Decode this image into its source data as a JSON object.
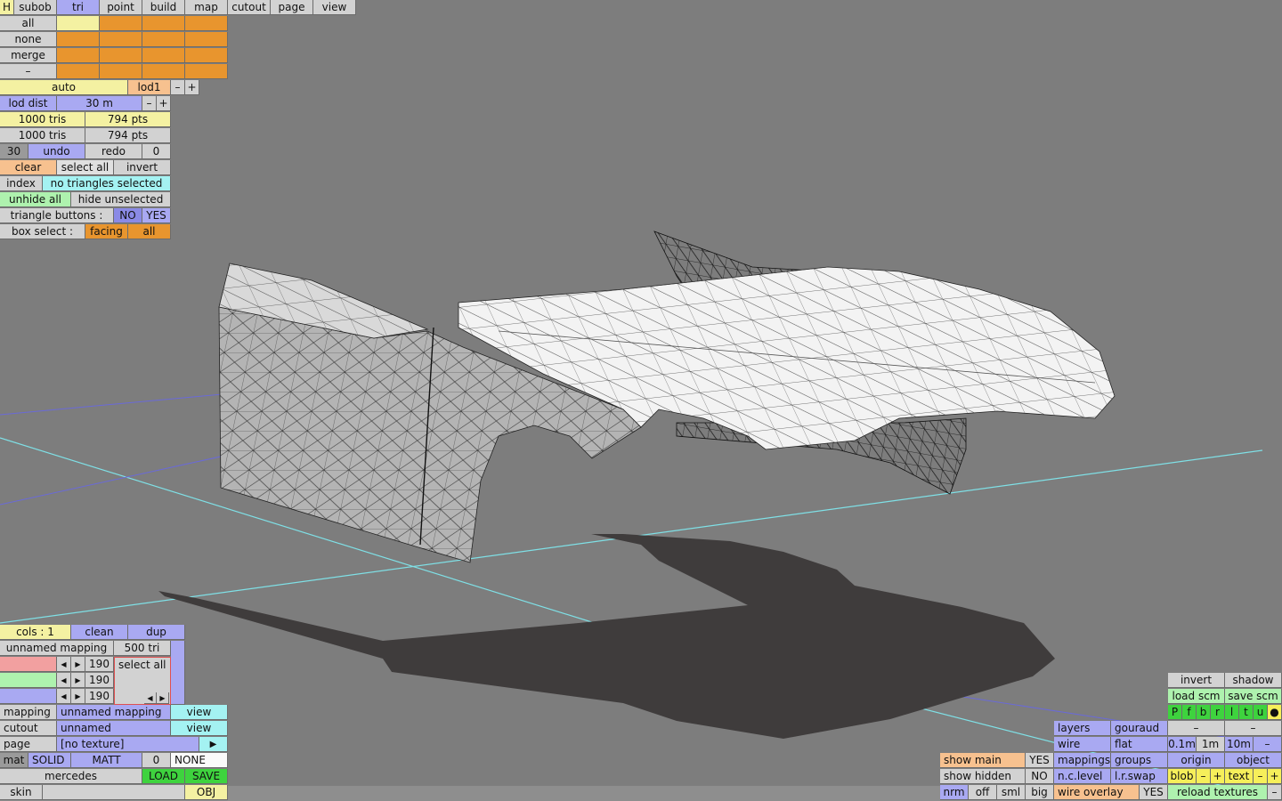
{
  "menu": {
    "h": "H",
    "tabs": [
      "subob",
      "tri",
      "point",
      "build",
      "map",
      "cutout",
      "page",
      "view"
    ],
    "active": "tri"
  },
  "selection": {
    "all": "all",
    "none": "none",
    "merge": "merge",
    "minus": "–"
  },
  "lod": {
    "auto": "auto",
    "level": "lod1",
    "minus": "–",
    "plus": "+",
    "dist_label": "lod dist",
    "dist_value": "30 m"
  },
  "counts": {
    "tris1": "1000 tris",
    "pts1": "794 pts",
    "tris2": "1000 tris",
    "pts2": "794 pts"
  },
  "history": {
    "steps": "30",
    "undo": "undo",
    "redo": "redo",
    "redo_count": "0"
  },
  "tri_tools": {
    "clear": "clear",
    "select_all": "select all",
    "invert": "invert",
    "index": "index",
    "status": "no triangles selected",
    "unhide_all": "unhide all",
    "hide_unselected": "hide unselected",
    "tri_buttons_label": "triangle buttons :",
    "no": "NO",
    "yes": "YES",
    "box_select_label": "box select :",
    "facing": "facing",
    "box_all": "all"
  },
  "mapping_panel": {
    "cols": "cols : 1",
    "clean": "clean",
    "dup": "dup",
    "mapping_name": "unnamed mapping",
    "tri_count": "500 tri",
    "rgb_values": [
      "190",
      "190",
      "190"
    ],
    "select_all": "select all",
    "mapping_label": "mapping",
    "mapping_value": "unnamed mapping",
    "view1": "view",
    "cutout_label": "cutout",
    "cutout_value": "unnamed",
    "view2": "view",
    "page_label": "page",
    "page_value": "[no texture]",
    "mat": "mat",
    "solid": "SOLID",
    "matt": "MATT",
    "mat_num": "0",
    "none": "NONE",
    "skin_name": "mercedes",
    "load": "LOAD",
    "save": "SAVE",
    "skin": "skin",
    "obj": "OBJ"
  },
  "view_panel": {
    "invert": "invert",
    "shadow": "shadow",
    "load_scm": "load scm",
    "save_scm": "save scm",
    "axes": [
      "P",
      "f",
      "b",
      "r",
      "l",
      "t",
      "u",
      "●"
    ],
    "dash1": "–",
    "dash2": "–",
    "layers": "layers",
    "gouraud": "gouraud",
    "scale_01": "0.1m",
    "scale_1": "1m",
    "scale_10": "10m",
    "scale_minus": "–",
    "wire": "wire",
    "flat": "flat",
    "show_main": "show main",
    "show_main_val": "YES",
    "mappings": "mappings",
    "groups": "groups",
    "origin": "origin",
    "object": "object",
    "show_hidden": "show hidden",
    "show_hidden_val": "NO",
    "nc_level": "n.c.level",
    "lr_swap": "l.r.swap",
    "blob": "blob",
    "blob_minus": "–",
    "blob_plus": "+",
    "text": "text",
    "text_minus": "–",
    "text_plus": "+",
    "nrm": "nrm",
    "off": "off",
    "sml": "sml",
    "big": "big",
    "wire_overlay": "wire overlay",
    "wire_overlay_val": "YES",
    "reload_textures": "reload textures",
    "reload_minus": "–"
  }
}
